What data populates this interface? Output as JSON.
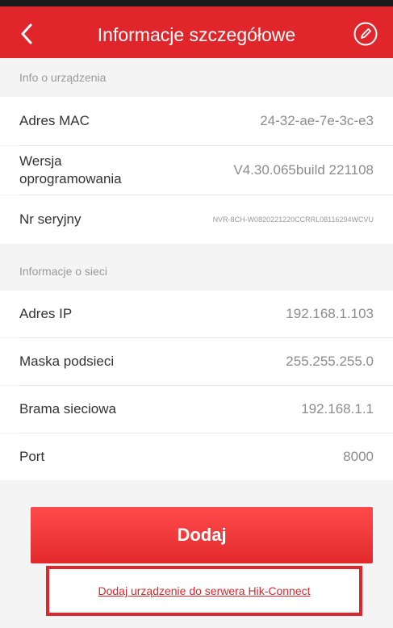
{
  "header": {
    "title": "Informacje szczegółowe",
    "back_icon": "back-chevron-icon",
    "edit_icon": "edit-pencil-icon"
  },
  "device_section": {
    "title": "Info o urządzenia",
    "rows": [
      {
        "label": "Adres MAC",
        "value": "24-32-ae-7e-3c-e3"
      },
      {
        "label_line1": "Wersja",
        "label_line2": "oprogramowania",
        "value": "V4.30.065build 221108"
      },
      {
        "label": "Nr seryjny",
        "value": "NVR-8CH-W0820221220CCRRL08116294WCVU"
      }
    ]
  },
  "network_section": {
    "title": "Informacje o sieci",
    "rows": [
      {
        "label": "Adres IP",
        "value": "192.168.1.103"
      },
      {
        "label": "Maska podsieci",
        "value": "255.255.255.0"
      },
      {
        "label": "Brama sieciowa",
        "value": "192.168.1.1"
      },
      {
        "label": "Port",
        "value": "8000"
      }
    ]
  },
  "actions": {
    "add_label": "Dodaj",
    "hik_connect_link": "Dodaj urządzenie do serwera Hik-Connect"
  },
  "colors": {
    "brand_red": "#e0262b",
    "muted_text": "#8c8c8c"
  }
}
